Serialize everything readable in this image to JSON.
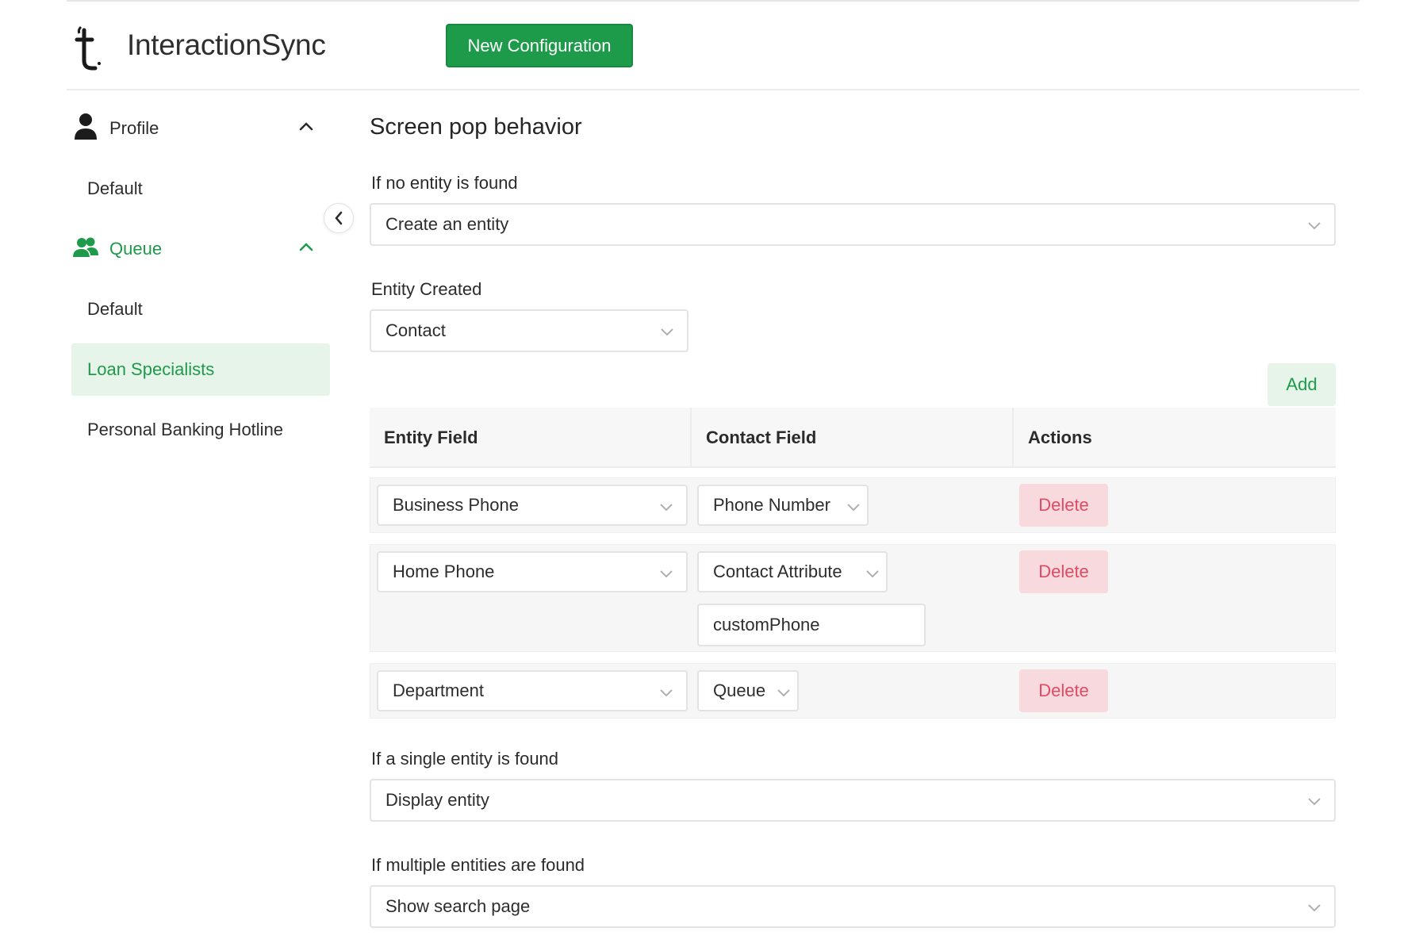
{
  "app": {
    "title": "InteractionSync",
    "new_config_label": "New Configuration"
  },
  "sidebar": {
    "groups": [
      {
        "label": "Profile",
        "icon": "person-icon",
        "items": [
          "Default"
        ]
      },
      {
        "label": "Queue",
        "icon": "people-icon",
        "items": [
          "Default",
          "Loan Specialists",
          "Personal Banking Hotline"
        ]
      }
    ],
    "active_item": "Loan Specialists"
  },
  "main": {
    "title": "Screen pop behavior",
    "no_entity": {
      "label": "If no entity is found",
      "value": "Create an entity"
    },
    "entity_created": {
      "label": "Entity Created",
      "value": "Contact"
    },
    "add_label": "Add",
    "table": {
      "headers": [
        "Entity Field",
        "Contact Field",
        "Actions"
      ],
      "rows": [
        {
          "entity_field": "Business Phone",
          "contact_field": "Phone Number",
          "action": "Delete"
        },
        {
          "entity_field": "Home Phone",
          "contact_field": "Contact Attribute",
          "extra_input": "customPhone",
          "action": "Delete"
        },
        {
          "entity_field": "Department",
          "contact_field": "Queue",
          "action": "Delete"
        }
      ]
    },
    "single_entity": {
      "label": "If a single entity is found",
      "value": "Display entity"
    },
    "multiple_entities": {
      "label": "If multiple entities are found",
      "value": "Show search page"
    }
  },
  "colors": {
    "brand_green": "#1e9b4a",
    "active_bg": "#e7f4ea",
    "delete_bg": "#f8d9de",
    "delete_text": "#de4b64"
  }
}
